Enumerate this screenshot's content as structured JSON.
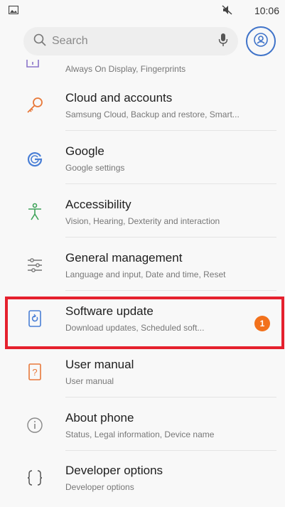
{
  "status_bar": {
    "time": "10:06"
  },
  "search": {
    "placeholder": "Search"
  },
  "partial_item": {
    "subtitle": "Always On Display, Fingerprints"
  },
  "items": [
    {
      "title": "Cloud and accounts",
      "subtitle": "Samsung Cloud, Backup and restore, Smart..."
    },
    {
      "title": "Google",
      "subtitle": "Google settings"
    },
    {
      "title": "Accessibility",
      "subtitle": "Vision, Hearing, Dexterity and interaction"
    },
    {
      "title": "General management",
      "subtitle": "Language and input, Date and time, Reset"
    },
    {
      "title": "Software update",
      "subtitle": "Download updates, Scheduled soft...",
      "badge": "1"
    },
    {
      "title": "User manual",
      "subtitle": "User manual"
    },
    {
      "title": "About phone",
      "subtitle": "Status, Legal information, Device name"
    },
    {
      "title": "Developer options",
      "subtitle": "Developer options"
    }
  ],
  "colors": {
    "accent": "#3f73c9",
    "highlight": "#e5202d",
    "badge": "#f2711c"
  }
}
